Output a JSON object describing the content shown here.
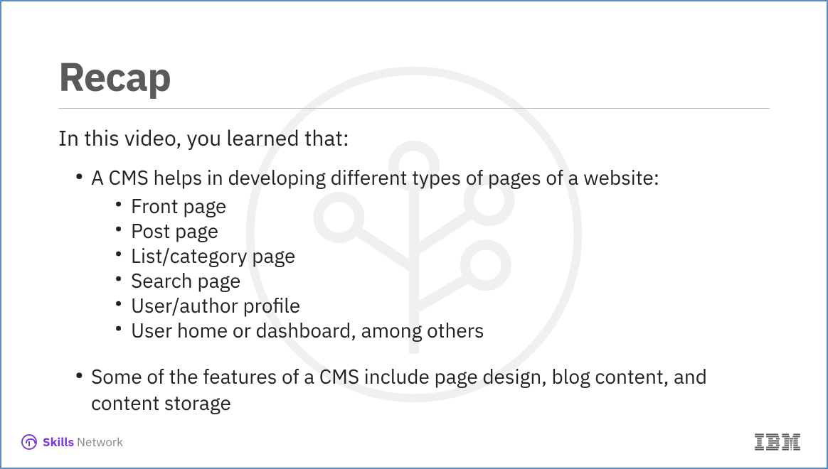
{
  "title": "Recap",
  "intro": "In this video, you learned that:",
  "bullets": [
    {
      "text": "A CMS helps in developing different types of pages of a website:",
      "sub": [
        "Front page",
        "Post page",
        "List/category page",
        "Search page",
        "User/author profile",
        "User home or dashboard, among others"
      ]
    },
    {
      "text": "Some of the features of a CMS include page design, blog content, and content storage",
      "sub": []
    }
  ],
  "footer": {
    "brand_bold": "Skills",
    "brand_gray": " Network",
    "ibm": "IBM"
  }
}
